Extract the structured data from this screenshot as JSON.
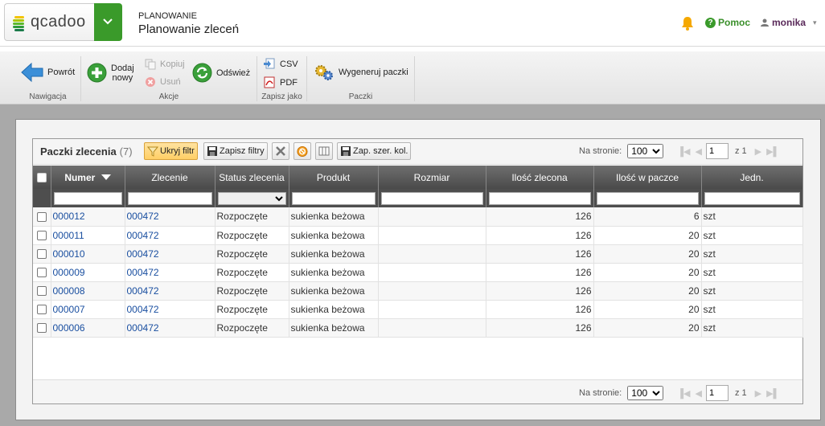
{
  "header": {
    "logo_text": "qcadoo",
    "section": "PLANOWANIE",
    "title": "Planowanie zleceń",
    "help_label": "Pomoc",
    "user_name": "monika"
  },
  "ribbon": {
    "groups": [
      {
        "label": "Nawigacja"
      },
      {
        "label": "Akcje"
      },
      {
        "label": "Zapisz jako"
      },
      {
        "label": "Paczki"
      }
    ],
    "back_label": "Powrót",
    "add_new_label_1": "Dodaj",
    "add_new_label_2": "nowy",
    "copy_label": "Kopiuj",
    "delete_label": "Usuń",
    "refresh_label": "Odśwież",
    "csv_label": "CSV",
    "pdf_label": "PDF",
    "generate_label": "Wygeneruj paczki"
  },
  "grid": {
    "title": "Paczki zlecenia",
    "count": "(7)",
    "hide_filter_label": "Ukryj filtr",
    "save_filters_label": "Zapisz filtry",
    "save_widths_label": "Zap. szer. kol.",
    "per_page_label": "Na stronie:",
    "per_page_value": "100",
    "page_value": "1",
    "page_of": "z 1",
    "columns": [
      "Numer",
      "Zlecenie",
      "Status zlecenia",
      "Produkt",
      "Rozmiar",
      "Ilość zlecona",
      "Ilość w paczce",
      "Jedn."
    ],
    "rows": [
      {
        "numer": "000012",
        "zlecenie": "000472",
        "status": "Rozpoczęte",
        "produkt": "sukienka beżowa",
        "rozmiar": "",
        "ilosc_zlecona": "126",
        "ilosc_w_paczce": "6",
        "jedn": "szt"
      },
      {
        "numer": "000011",
        "zlecenie": "000472",
        "status": "Rozpoczęte",
        "produkt": "sukienka beżowa",
        "rozmiar": "",
        "ilosc_zlecona": "126",
        "ilosc_w_paczce": "20",
        "jedn": "szt"
      },
      {
        "numer": "000010",
        "zlecenie": "000472",
        "status": "Rozpoczęte",
        "produkt": "sukienka beżowa",
        "rozmiar": "",
        "ilosc_zlecona": "126",
        "ilosc_w_paczce": "20",
        "jedn": "szt"
      },
      {
        "numer": "000009",
        "zlecenie": "000472",
        "status": "Rozpoczęte",
        "produkt": "sukienka beżowa",
        "rozmiar": "",
        "ilosc_zlecona": "126",
        "ilosc_w_paczce": "20",
        "jedn": "szt"
      },
      {
        "numer": "000008",
        "zlecenie": "000472",
        "status": "Rozpoczęte",
        "produkt": "sukienka beżowa",
        "rozmiar": "",
        "ilosc_zlecona": "126",
        "ilosc_w_paczce": "20",
        "jedn": "szt"
      },
      {
        "numer": "000007",
        "zlecenie": "000472",
        "status": "Rozpoczęte",
        "produkt": "sukienka beżowa",
        "rozmiar": "",
        "ilosc_zlecona": "126",
        "ilosc_w_paczce": "20",
        "jedn": "szt"
      },
      {
        "numer": "000006",
        "zlecenie": "000472",
        "status": "Rozpoczęte",
        "produkt": "sukienka beżowa",
        "rozmiar": "",
        "ilosc_zlecona": "126",
        "ilosc_w_paczce": "20",
        "jedn": "szt"
      }
    ]
  },
  "colors": {
    "brand_green": "#3a9a2a",
    "link_blue": "#1a4fa0",
    "header_gray": "#4a4a4a",
    "active_button": "#ffcf66"
  }
}
